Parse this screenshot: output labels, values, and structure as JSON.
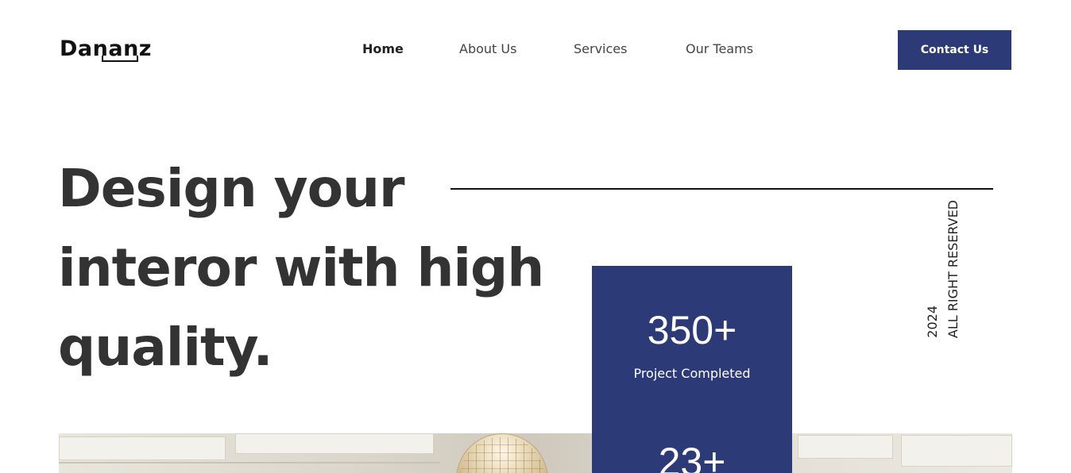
{
  "header": {
    "logo_text": "Dananz",
    "nav": [
      {
        "label": "Home",
        "active": true
      },
      {
        "label": "About Us",
        "active": false
      },
      {
        "label": "Services",
        "active": false
      },
      {
        "label": "Our Teams",
        "active": false
      }
    ],
    "contact_label": "Contact Us"
  },
  "hero": {
    "title_line1": "Design your",
    "title_line2": "interor with high",
    "title_line3": "quality."
  },
  "side_text": {
    "year": "2024",
    "rights": "ALL RIGHT RESERVED"
  },
  "stats": [
    {
      "value": "350+",
      "label": "Project Completed"
    },
    {
      "value": "23+",
      "label": ""
    }
  ],
  "colors": {
    "brand": "#2d3a78",
    "text": "#333333",
    "background": "#ffffff"
  }
}
